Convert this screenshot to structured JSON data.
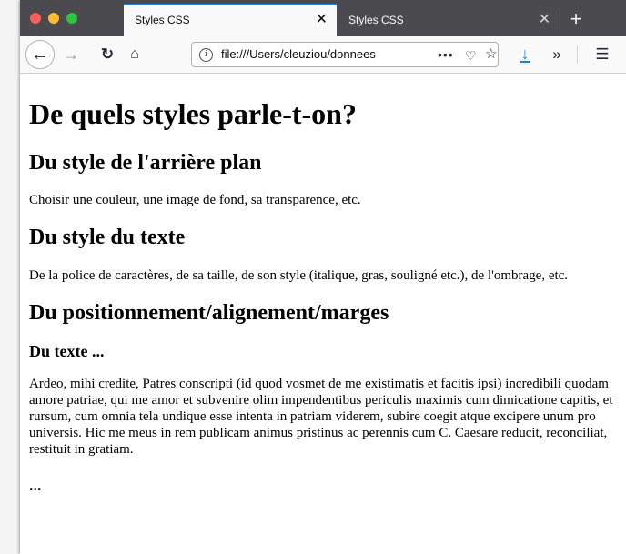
{
  "browser": {
    "tabs": [
      {
        "label": "Styles CSS",
        "active": true
      },
      {
        "label": "Styles CSS",
        "active": false
      }
    ],
    "new_tab_glyph": "+",
    "close_glyph": "✕",
    "url": "file:///Users/cleuziou/donnees",
    "page_actions_glyph": "•••",
    "icons": [
      "back-icon",
      "forward-icon",
      "reload-icon",
      "home-icon",
      "info-icon",
      "page-actions-icon",
      "pocket-icon",
      "bookmark-star-icon",
      "download-icon",
      "overflow-icon",
      "menu-icon"
    ],
    "accent_color": "#0a84ff"
  },
  "page": {
    "h1": "De quels styles parle-t-on?",
    "section_background": {
      "title": "Du style de l'arrière plan",
      "text": "Choisir une couleur, une image de fond, sa transparence, etc."
    },
    "section_text": {
      "title": "Du style du texte",
      "text": "De la police de caractères, de sa taille, de son style (italique, gras, souligné etc.), de l'ombrage, etc."
    },
    "section_position": {
      "title": "Du positionnement/alignement/marges",
      "sub1_title": "Du texte ...",
      "sub1_text": "Ardeo, mihi credite, Patres conscripti (id quod vosmet de me existimatis et facitis ipsi) incredibili quodam amore patriae, qui me amor et subvenire olim impendentibus periculis maximis cum dimicatione capitis, et rursum, cum omnia tela undique esse intenta in patriam viderem, subire coegit atque excipere unum pro universis. Hic me meus in rem publicam animus pristinus ac perennis cum C. Caesare reducit, reconciliat, restituit in gratiam.",
      "sub2_title": "..."
    }
  }
}
